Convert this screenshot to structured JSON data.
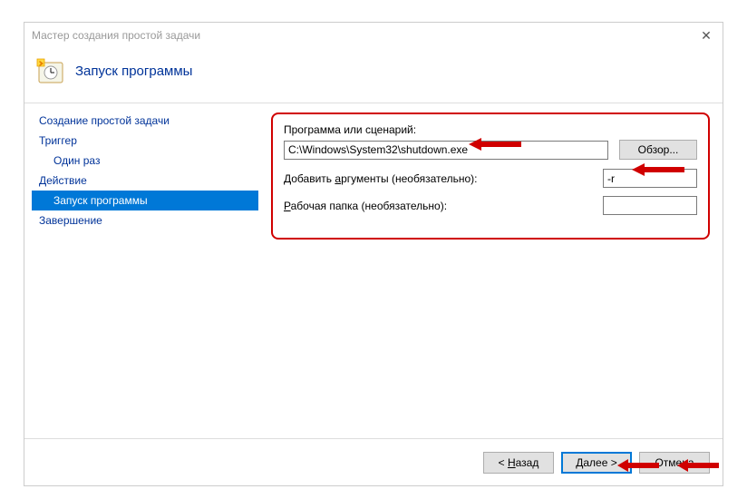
{
  "window": {
    "title": "Мастер создания простой задачи",
    "heading": "Запуск программы"
  },
  "sidebar": {
    "items": [
      {
        "label": "Создание простой задачи",
        "indent": false,
        "selected": false
      },
      {
        "label": "Триггер",
        "indent": false,
        "selected": false
      },
      {
        "label": "Один раз",
        "indent": true,
        "selected": false
      },
      {
        "label": "Действие",
        "indent": false,
        "selected": false
      },
      {
        "label": "Запуск программы",
        "indent": true,
        "selected": true
      },
      {
        "label": "Завершение",
        "indent": false,
        "selected": false
      }
    ]
  },
  "form": {
    "program_label": "Программа или сценарий:",
    "program_value": "C:\\Windows\\System32\\shutdown.exe",
    "browse_label": "Обзор...",
    "arguments_label_pre": "Добавить ",
    "arguments_label_u": "а",
    "arguments_label_post": "ргументы (необязательно):",
    "arguments_value": "-r",
    "workdir_label_pre": "",
    "workdir_label_u": "Р",
    "workdir_label_post": "абочая папка (необязательно):",
    "workdir_value": ""
  },
  "footer": {
    "back_pre": "< ",
    "back_u": "Н",
    "back_post": "азад",
    "next_pre": "",
    "next_u": "Д",
    "next_post": "алее >",
    "cancel": "Отмена"
  }
}
